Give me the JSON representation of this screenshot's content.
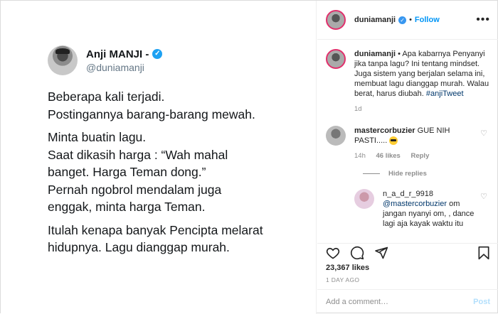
{
  "tweet": {
    "name": "Anji MANJI -",
    "handle": "@duniamanji",
    "paragraphs": [
      [
        "Beberapa kali terjadi.",
        "Postingannya barang-barang mewah."
      ],
      [
        "Minta buatin lagu.",
        "Saat dikasih harga : “Wah mahal",
        "banget. Harga Teman dong.”",
        "Pernah ngobrol mendalam juga",
        "enggak, minta harga Teman."
      ],
      [
        "Itulah kenapa banyak Pencipta melarat",
        "hidupnya. Lagu dianggap murah."
      ]
    ]
  },
  "header": {
    "username": "duniamanji",
    "separator": "•",
    "follow_label": "Follow",
    "more_label": "•••"
  },
  "caption": {
    "username": "duniamanji",
    "text": " • Apa kabarnya Penyanyi jika tanpa lagu? Ini tentang mindset. Juga sistem yang berjalan selama ini, membuat lagu dianggap murah. Walau berat, harus diubah. ",
    "hashtag": "#anjiTweet",
    "age": "1d"
  },
  "comment1": {
    "username": "mastercorbuzier",
    "text": " GUE NIH PASTI..... ",
    "age": "14h",
    "likes": "46 likes",
    "reply_label": "Reply"
  },
  "hide_replies_label": "Hide replies",
  "reply1": {
    "username": "n_a_d_r_9918",
    "mention": "@mastercorbuzier",
    "text": " om jangan nyanyi om, , dance lagi aja kayak waktu itu"
  },
  "actions": {
    "likes": "23,367 likes",
    "time_ago": "1 DAY AGO"
  },
  "add_comment": {
    "placeholder": "Add a comment…",
    "post_label": "Post"
  },
  "colors": {
    "follow_blue": "#0095f6",
    "verified_blue": "#3897f0",
    "twitter_blue": "#1da1f2",
    "link_navy": "#00376b"
  }
}
